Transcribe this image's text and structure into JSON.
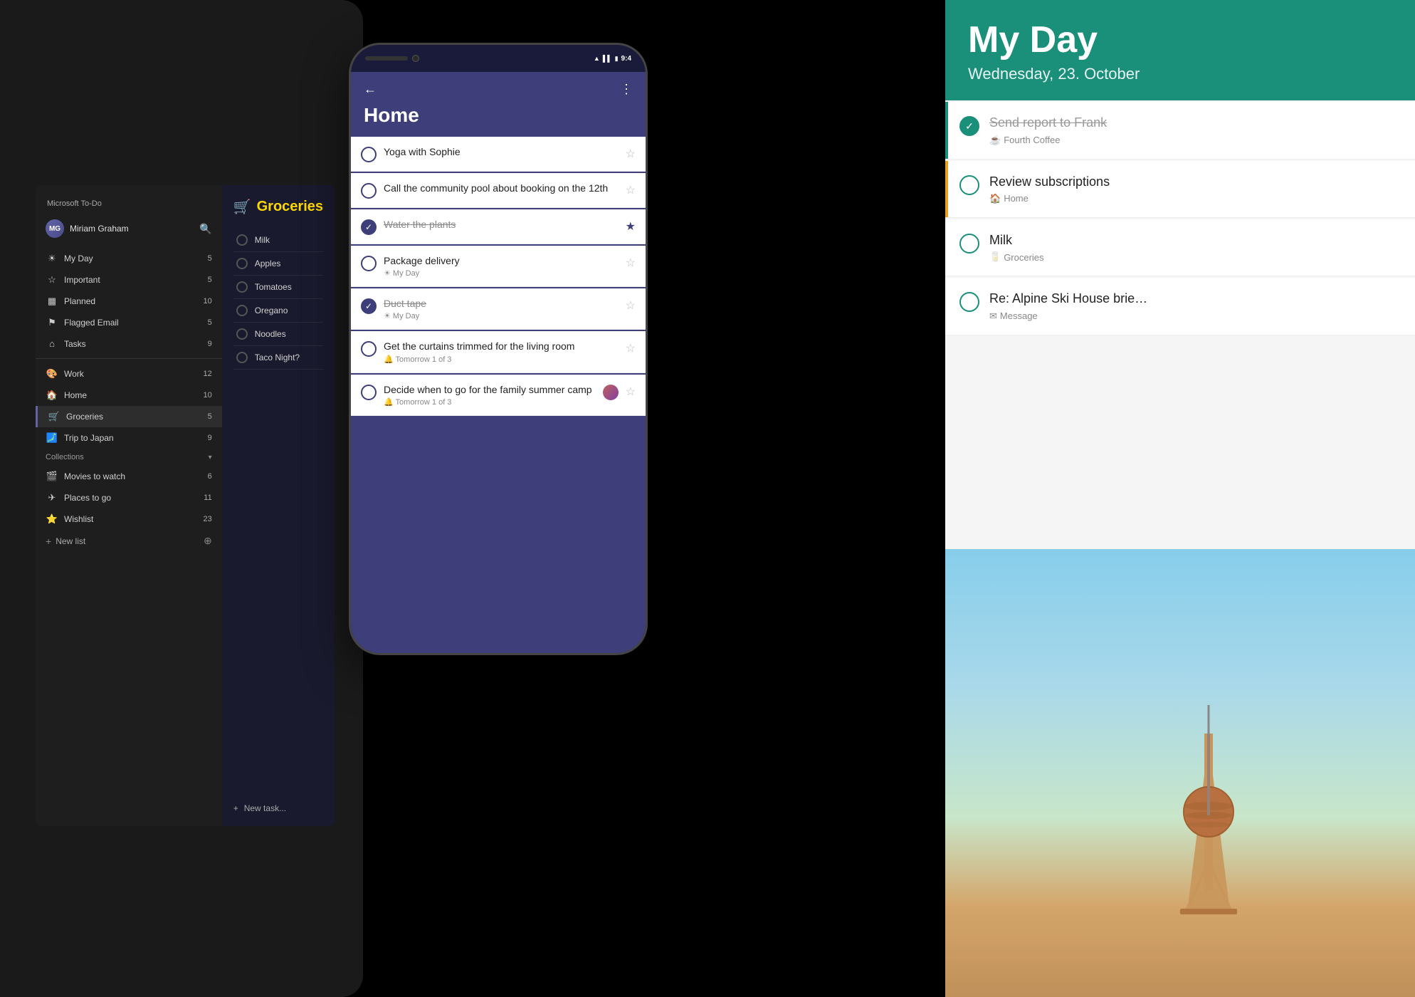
{
  "app_name": "Microsoft To-Do",
  "tablet": {
    "brand": "Microsoft To-Do",
    "user": {
      "name": "Miriam Graham",
      "initials": "MG"
    },
    "nav_items": [
      {
        "id": "my-day",
        "icon": "☀",
        "label": "My Day",
        "count": "5"
      },
      {
        "id": "important",
        "icon": "☆",
        "label": "Important",
        "count": "5"
      },
      {
        "id": "planned",
        "icon": "▦",
        "label": "Planned",
        "count": "10"
      },
      {
        "id": "flagged-email",
        "icon": "⚑",
        "label": "Flagged Email",
        "count": "5"
      },
      {
        "id": "tasks",
        "icon": "⌂",
        "label": "Tasks",
        "count": "9"
      },
      {
        "id": "work",
        "icon": "🎨",
        "label": "Work",
        "count": "12"
      },
      {
        "id": "home",
        "icon": "🏠",
        "label": "Home",
        "count": "10"
      },
      {
        "id": "groceries",
        "icon": "🛒",
        "label": "Groceries",
        "count": "5"
      },
      {
        "id": "trip-to-japan",
        "icon": "🗾",
        "label": "Trip to Japan",
        "count": "9"
      }
    ],
    "collections_label": "Collections",
    "collection_items": [
      {
        "id": "movies",
        "icon": "🎬",
        "label": "Movies to watch",
        "count": "6"
      },
      {
        "id": "places",
        "icon": "✈",
        "label": "Places to go",
        "count": "11"
      },
      {
        "id": "wishlist",
        "icon": "⭐",
        "label": "Wishlist",
        "count": "23"
      }
    ],
    "new_list_label": "New list",
    "groceries_panel": {
      "title": "Groceries",
      "emoji": "🛒",
      "items": [
        {
          "name": "Milk"
        },
        {
          "name": "Apples"
        },
        {
          "name": "Tomatoes"
        },
        {
          "name": "Oregano"
        },
        {
          "name": "Noodles"
        },
        {
          "name": "Taco Night?"
        }
      ],
      "new_task_label": "New task..."
    }
  },
  "phone": {
    "status_time": "9:4",
    "back_icon": "←",
    "more_icon": "⋮",
    "list_title": "Home",
    "tasks": [
      {
        "id": "yoga",
        "title": "Yoga with Sophie",
        "subtitle": "",
        "checked": false,
        "starred": false,
        "star_filled": false
      },
      {
        "id": "pool",
        "title": "Call the community pool about booking on the 12th",
        "subtitle": "",
        "checked": false,
        "starred": false,
        "star_filled": false
      },
      {
        "id": "plants",
        "title": "Water the plants",
        "subtitle": "",
        "checked": true,
        "starred": true,
        "star_filled": true
      },
      {
        "id": "package",
        "title": "Package delivery",
        "subtitle": "☀ My Day",
        "checked": false,
        "starred": false,
        "star_filled": false
      },
      {
        "id": "duct-tape",
        "title": "Duct tape",
        "subtitle": "☀ My Day",
        "checked": true,
        "starred": false,
        "star_filled": false
      },
      {
        "id": "curtains",
        "title": "Get the curtains trimmed for the living room",
        "subtitle": "🔔 Tomorrow 1 of 3",
        "checked": false,
        "starred": false,
        "star_filled": false
      },
      {
        "id": "summer-camp",
        "title": "Decide when to go for the family summer camp",
        "subtitle": "🔔 Tomorrow 1 of 3",
        "checked": false,
        "has_avatar": true,
        "starred": false,
        "star_filled": false
      }
    ]
  },
  "myday": {
    "title": "My Day",
    "date": "Wednesday, 23. October",
    "tasks": [
      {
        "id": "send-report",
        "title": "Send report to Frank",
        "subtitle_icon": "☕",
        "subtitle": "Fourth Coffee",
        "checked": true,
        "strikethrough": true,
        "border": "teal"
      },
      {
        "id": "review-subs",
        "title": "Review subscriptions",
        "subtitle_icon": "🏠",
        "subtitle": "Home",
        "checked": false,
        "strikethrough": false,
        "border": "orange"
      },
      {
        "id": "milk",
        "title": "Milk",
        "subtitle_icon": "🥛",
        "subtitle": "Groceries",
        "checked": false,
        "strikethrough": false,
        "border": "none"
      },
      {
        "id": "alpine-ski",
        "title": "Re: Alpine Ski House brie…",
        "subtitle_icon": "✉",
        "subtitle": "Message",
        "checked": false,
        "strikethrough": false,
        "border": "none"
      }
    ],
    "photo_alt": "Berlin TV Tower"
  }
}
